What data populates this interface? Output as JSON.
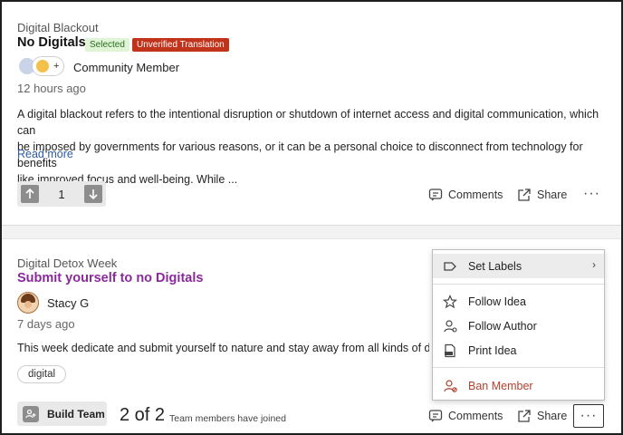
{
  "post1": {
    "category": "Digital Blackout",
    "title": "No Digitals",
    "badge_selected": "Selected",
    "badge_unverified": "Unverified Translation",
    "author": "Community Member",
    "time": "12 hours ago",
    "body_line1": "A digital blackout refers to the intentional disruption or shutdown of internet access and digital communication, which can",
    "body_line2": "be imposed by governments for various reasons, or it can be a personal choice to disconnect from technology for benefits",
    "body_line3": "like improved focus and well-being. While ...",
    "read_more": "Read more",
    "vote_count": "1",
    "comments_label": "Comments",
    "share_label": "Share",
    "more_label": "···",
    "avatar_plus": "+"
  },
  "post2": {
    "category": "Digital Detox Week",
    "title": "Submit yourself to no Digitals",
    "author": "Stacy G",
    "time": "7 days ago",
    "body": "This week dedicate and submit yourself to nature and stay away from all kinds of digita",
    "tag": "digital",
    "build_team_label": "Build Team",
    "team_count": "2 of 2",
    "team_text": "Team members have joined",
    "comments_label": "Comments",
    "share_label": "Share",
    "more_label": "···"
  },
  "menu": {
    "items": [
      {
        "label": "Set Labels",
        "icon": "label-icon"
      },
      {
        "label": "Follow Idea",
        "icon": "star-icon"
      },
      {
        "label": "Follow Author",
        "icon": "follow-user-icon"
      },
      {
        "label": "Print Idea",
        "icon": "pdf-icon"
      },
      {
        "label": "Ban Member",
        "icon": "ban-user-icon"
      }
    ],
    "chevron": "›"
  },
  "colors": {
    "accent_title": "#8a2a9a",
    "link": "#2c5aa0",
    "unverified_badge": "#c2331b",
    "selected_badge": "#dff5d6",
    "danger": "#b4412f"
  }
}
